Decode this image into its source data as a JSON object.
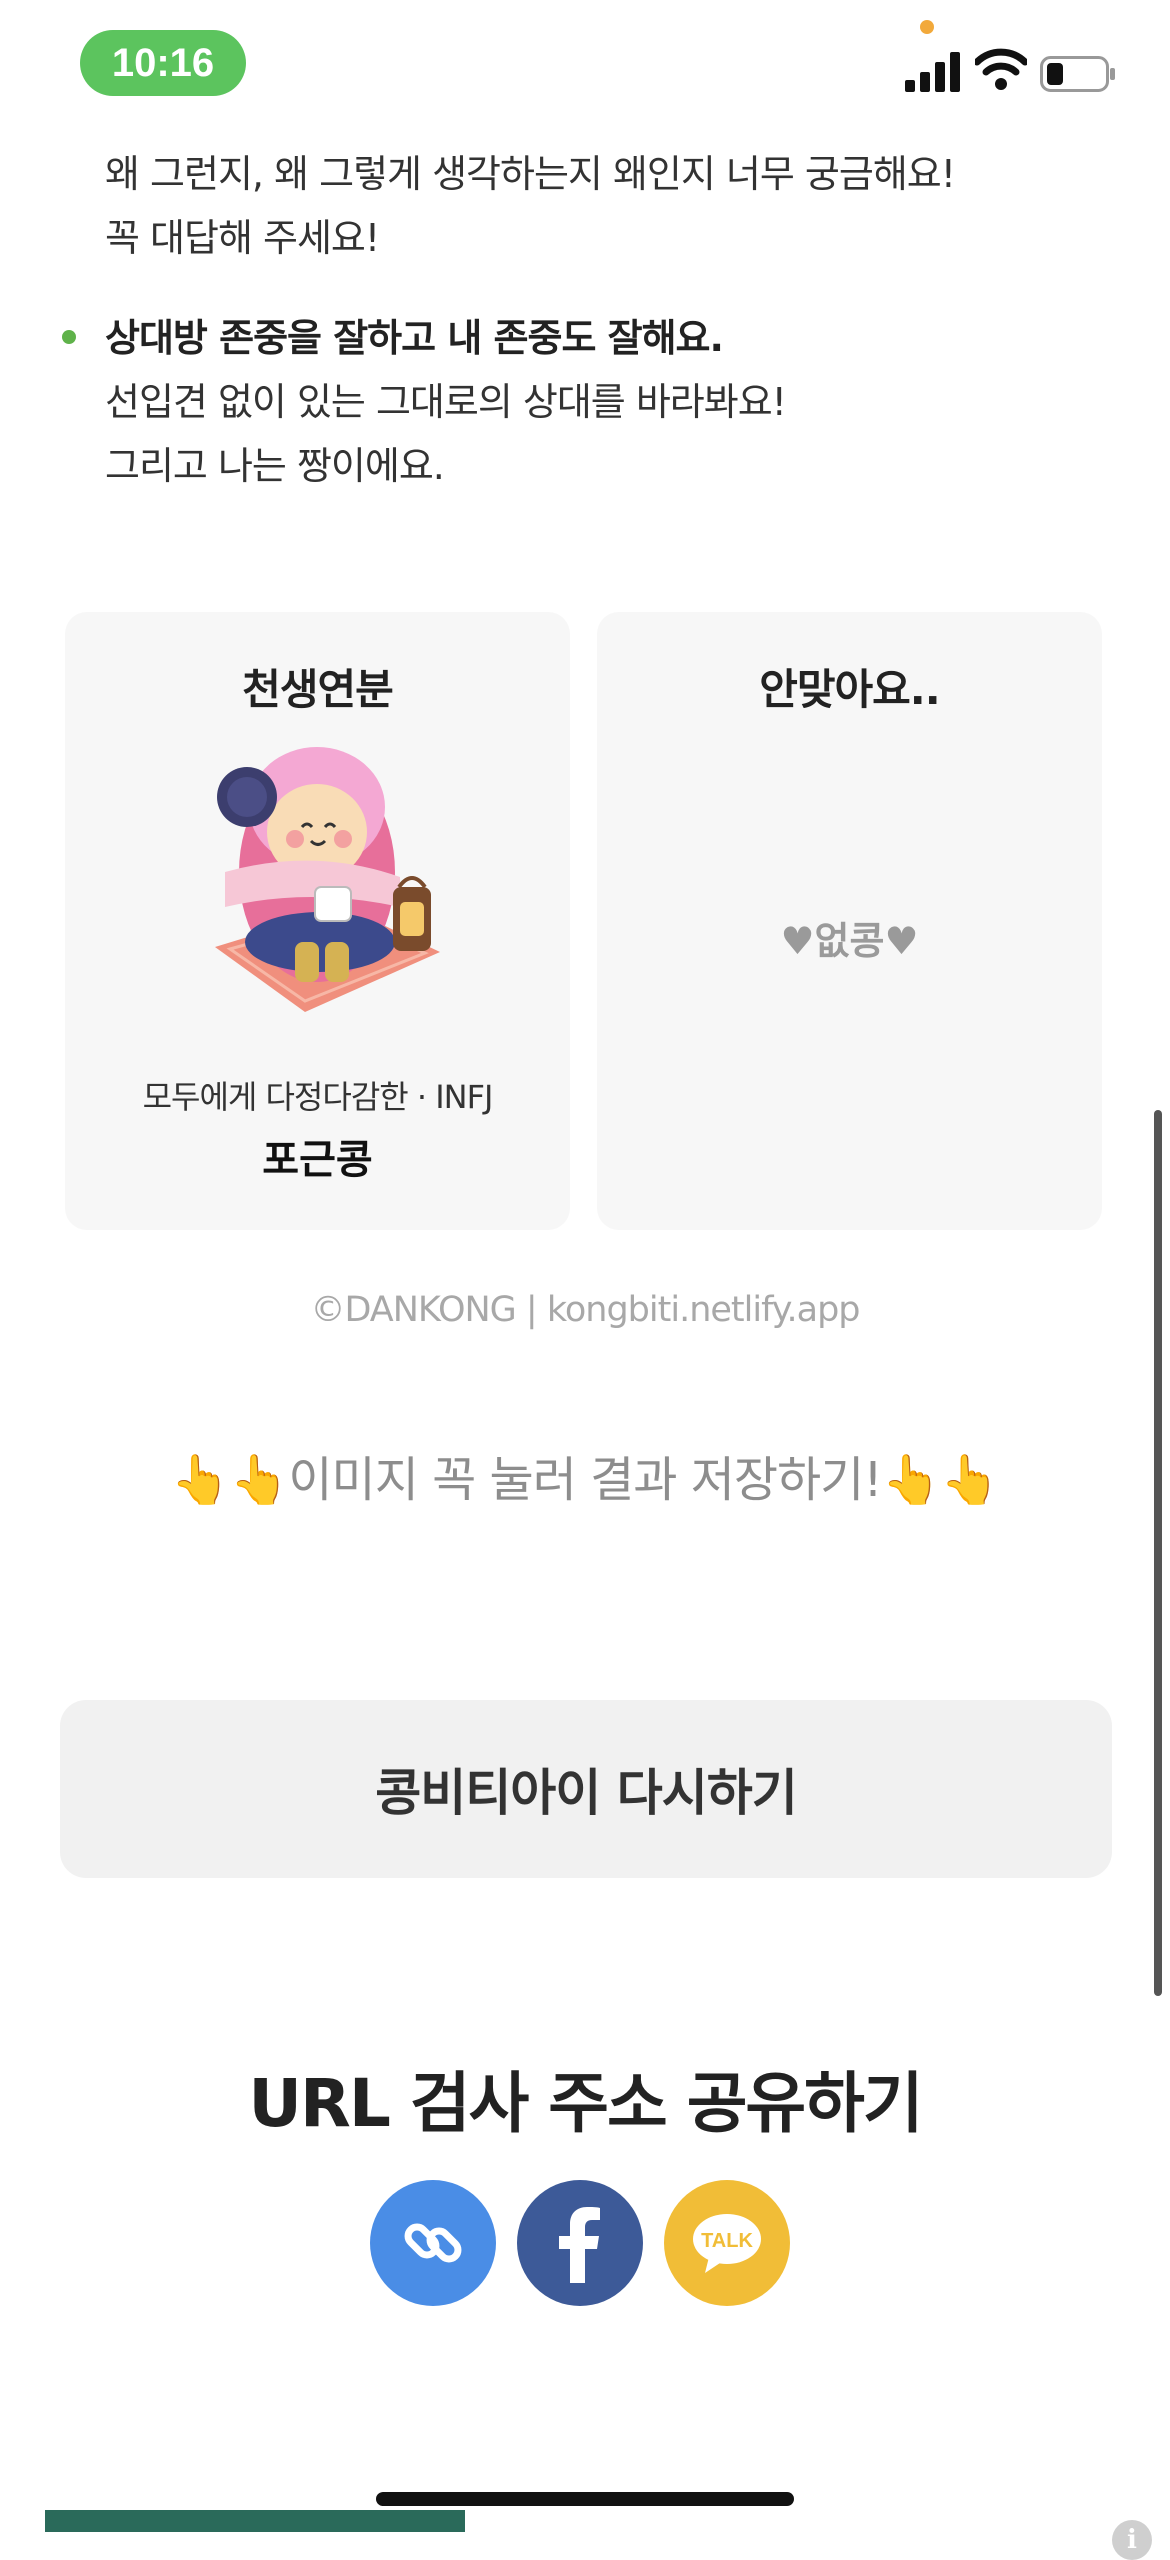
{
  "status_bar": {
    "time": "10:16"
  },
  "text": {
    "line1": "왜 그런지, 왜 그렇게 생각하는지 왜인지 너무 궁금해요!",
    "line2": "꼭 대답해 주세요!",
    "bullet_title": "상대방 존중을 잘하고 내 존중도 잘해요.",
    "bullet_line1": "선입견 없이 있는 그대로의 상대를 바라봐요!",
    "bullet_line2": "그리고 나는 짱이에요."
  },
  "cards": {
    "match": {
      "title": "천생연분",
      "subtitle": "모두에게 다정다감한 · INFJ",
      "name": "포근콩"
    },
    "mismatch": {
      "title": "안맞아요..",
      "content": "♥없콩♥"
    }
  },
  "footer": {
    "credit": "©DANKONG | kongbiti.netlify.app",
    "save_hint": "이미지 꼭 눌러 결과 저장하기!",
    "retry_label": "콩비티아이 다시하기",
    "share_title": "URL 검사 주소 공유하기"
  },
  "share_buttons": [
    {
      "name": "link-share",
      "icon": "link-icon",
      "color": "#4a8de6"
    },
    {
      "name": "facebook-share",
      "icon": "facebook-icon",
      "color": "#3d5a98"
    },
    {
      "name": "kakao-share",
      "icon": "kakao-talk-icon",
      "label": "TALK",
      "color": "#f1bd37"
    }
  ],
  "colors": {
    "status_pill": "#5cc45e",
    "bullet": "#5fb24a",
    "card_bg": "#f7f7f7",
    "button_bg": "#f1f1f1"
  }
}
